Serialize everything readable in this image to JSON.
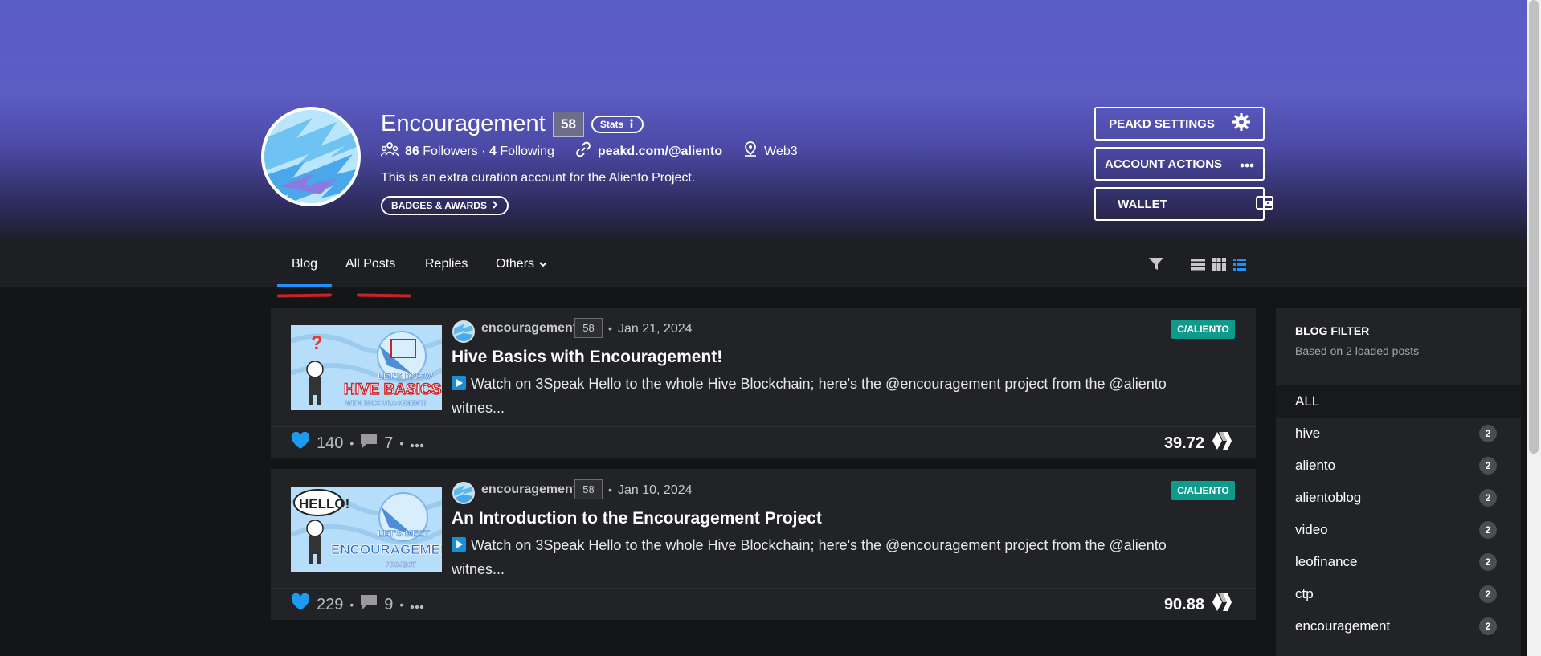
{
  "profile": {
    "name": "Encouragement",
    "reputation": "58",
    "stats_label": "Stats",
    "followers_count": "86",
    "followers_label": "Followers",
    "separator": "·",
    "following_count": "4",
    "following_label": "Following",
    "website": "peakd.com/@aliento",
    "location": "Web3",
    "bio": "This is an extra curation account for the Aliento Project.",
    "badges_label": "BADGES & AWARDS"
  },
  "actions": {
    "settings_label": "PEAKD SETTINGS",
    "account_actions_label": "ACCOUNT ACTIONS",
    "wallet_label": "WALLET"
  },
  "tabs": [
    {
      "label": "Blog"
    },
    {
      "label": "All Posts"
    },
    {
      "label": "Replies"
    },
    {
      "label": "Others"
    }
  ],
  "posts": [
    {
      "author": "encouragement",
      "reputation": "58",
      "date": "Jan 21, 2024",
      "community": "C/ALIENTO",
      "title": "Hive Basics with Encouragement!",
      "excerpt": "Watch on 3Speak Hello to the whole Hive Blockchain; here's the @encouragement project from the @aliento witnes...",
      "votes": "140",
      "comments": "7",
      "payout": "39.72",
      "thumb_lines": [
        "LET'S KNOW",
        "HIVE BASICS",
        "WITH ENCOURAGEMENT!"
      ]
    },
    {
      "author": "encouragement",
      "reputation": "58",
      "date": "Jan 10, 2024",
      "community": "C/ALIENTO",
      "title": "An Introduction to the Encouragement Project",
      "excerpt": "Watch on 3Speak Hello to the whole Hive Blockchain; here's the @encouragement project from the @aliento witnes...",
      "votes": "229",
      "comments": "9",
      "payout": "90.88",
      "thumb_lines": [
        "LET'S MEET",
        "ENCOURAGEMENT",
        "PROJECT"
      ],
      "thumb_bubble": "HELLO!"
    }
  ],
  "sidebar": {
    "title": "BLOG FILTER",
    "subtitle": "Based on 2 loaded posts",
    "all_label": "ALL",
    "tags": [
      {
        "name": "hive",
        "count": "2"
      },
      {
        "name": "aliento",
        "count": "2"
      },
      {
        "name": "alientoblog",
        "count": "2"
      },
      {
        "name": "video",
        "count": "2"
      },
      {
        "name": "leofinance",
        "count": "2"
      },
      {
        "name": "ctp",
        "count": "2"
      },
      {
        "name": "encouragement",
        "count": "2"
      }
    ]
  },
  "colors": {
    "banner": "#5a5cc6",
    "accent_blue": "#1e90ff",
    "community_badge": "#0e9b8c",
    "annotation_red": "#c8222a"
  },
  "icons": [
    "followers-icon",
    "link-icon",
    "location-pin-icon",
    "info-icon",
    "chevron-right-icon",
    "gear-icon",
    "more-dots-icon",
    "wallet-icon",
    "chevron-down-icon",
    "filter-icon",
    "list-view-icon",
    "grid-view-icon",
    "compact-list-icon",
    "heart-icon",
    "comment-icon",
    "hive-logo-icon",
    "play-icon"
  ]
}
